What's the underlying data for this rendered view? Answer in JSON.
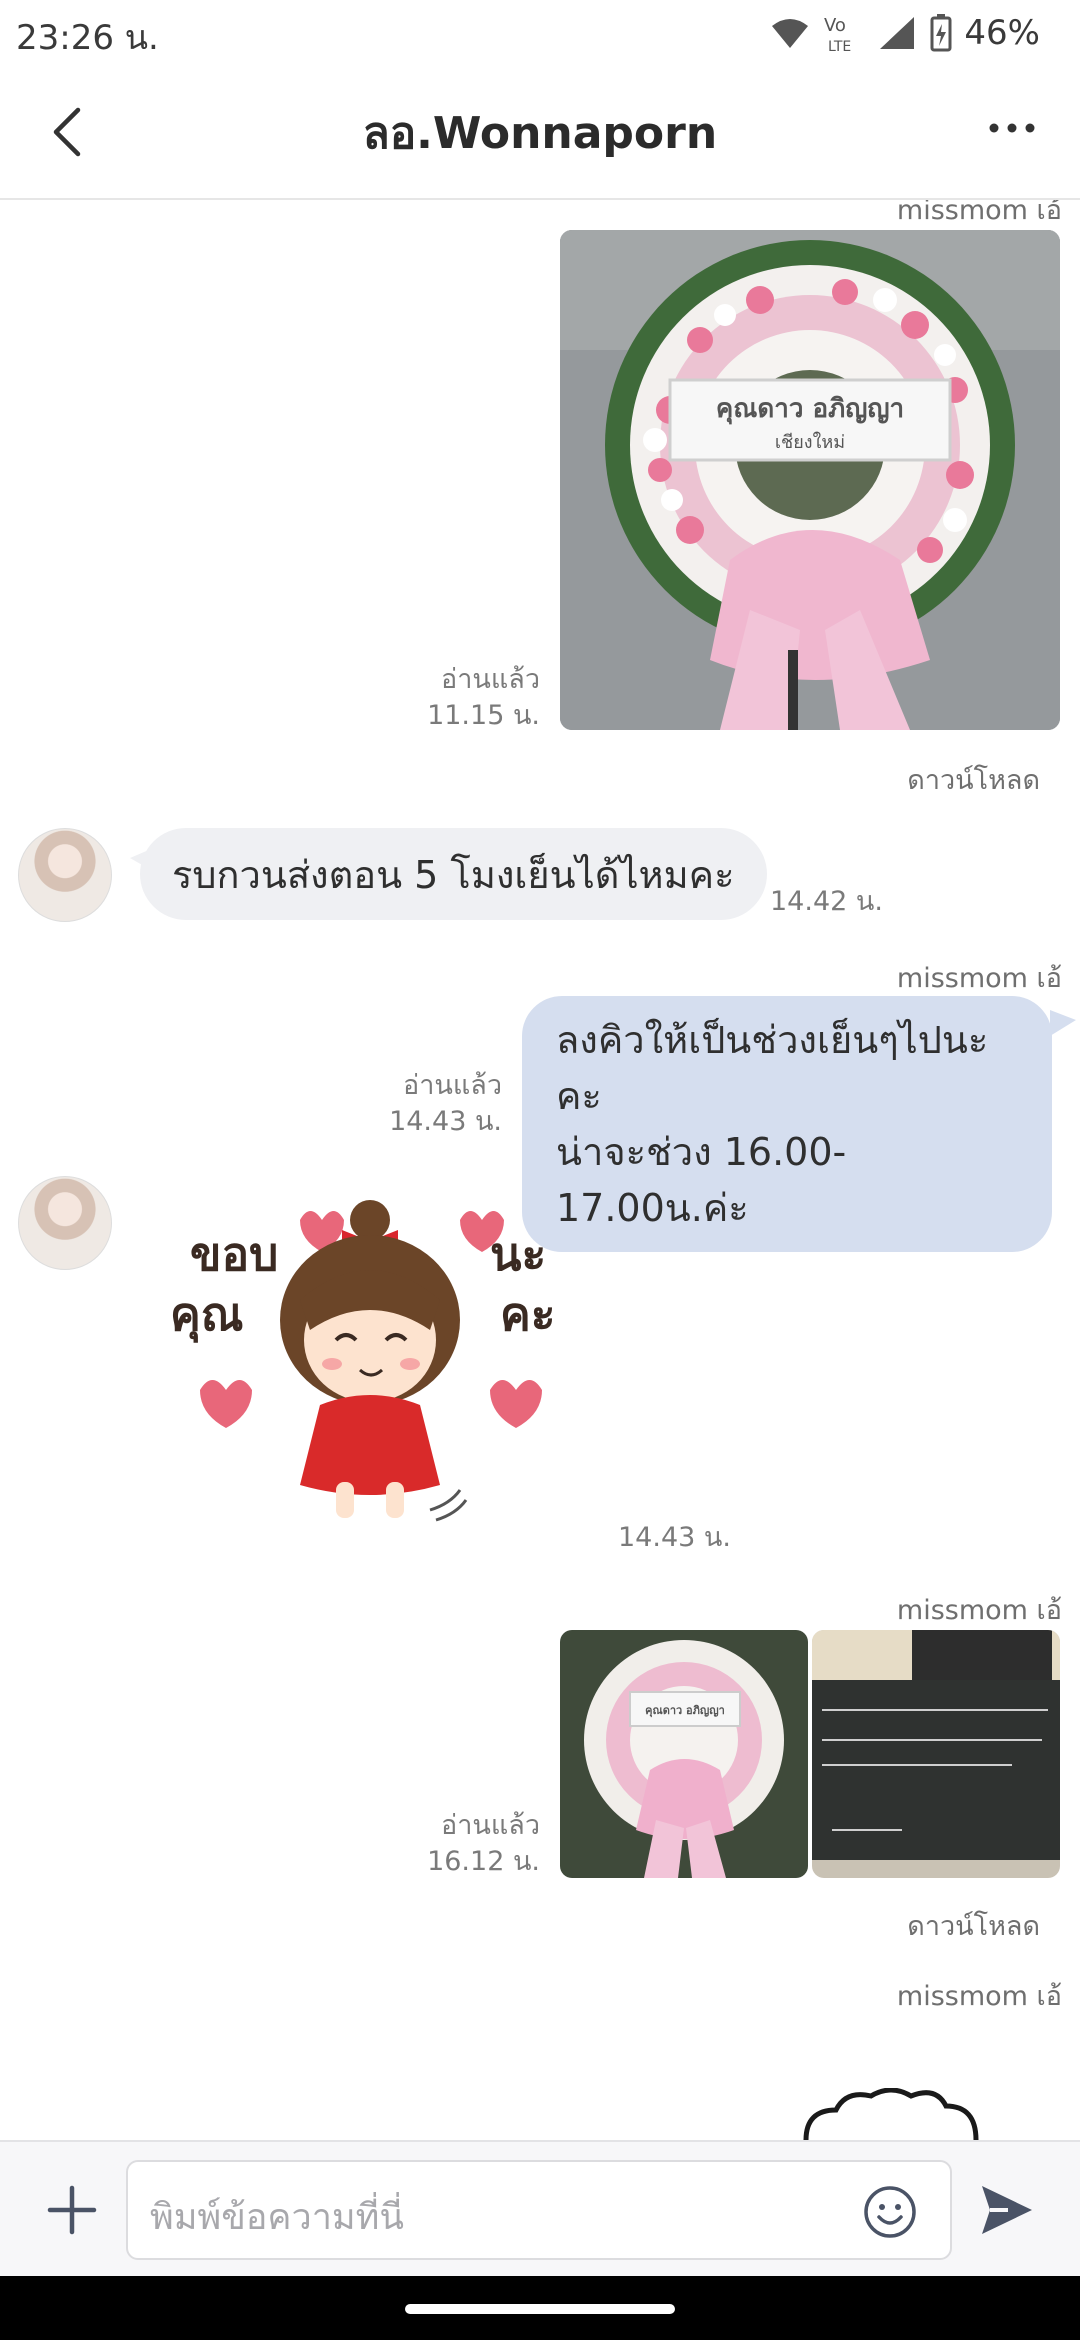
{
  "status_bar": {
    "time": "23:26 น.",
    "battery": "46%"
  },
  "header": {
    "title": "ลอ.Wonnaporn"
  },
  "messages": {
    "m1": {
      "sender": "missmom เอ้",
      "read": "อ่านแล้ว",
      "time": "11.15 น.",
      "photo_banner_line1": "คุณดาว อภิญญา",
      "photo_banner_line2": "เชียงใหม่",
      "download": "ดาวน์โหลด"
    },
    "m2": {
      "text": "รบกวนส่งตอน 5 โมงเย็นได้ไหมคะ",
      "time": "14.42 น."
    },
    "m3": {
      "sender": "missmom เอ้",
      "line1": "ลงคิวให้เป็นช่วงเย็นๆไปนะคะ",
      "line2": "น่าจะช่วง 16.00-17.00น.ค่ะ",
      "read": "อ่านแล้ว",
      "time": "14.43 น."
    },
    "m4": {
      "sticker_word1": "ขอบ",
      "sticker_word2": "คุณ",
      "sticker_word3": "นะ",
      "sticker_word4": "คะ",
      "time": "14.43 น."
    },
    "m5": {
      "sender": "missmom เอ้",
      "read": "อ่านแล้ว",
      "time": "16.12 น.",
      "photo_banner": "คุณดาว อภิญญา",
      "download": "ดาวน์โหลด"
    },
    "m6": {
      "sender": "missmom เอ้"
    }
  },
  "input": {
    "placeholder": "พิมพ์ข้อความที่นี่"
  },
  "icons": {
    "back": "chevron-left-icon",
    "more": "more-dots-icon",
    "plus": "plus-icon",
    "emoji": "smiley-icon",
    "send": "send-icon"
  },
  "colors": {
    "outgoing_bubble": "#d5deef",
    "incoming_bubble": "#eff0f3",
    "accent": "#4a5366"
  }
}
